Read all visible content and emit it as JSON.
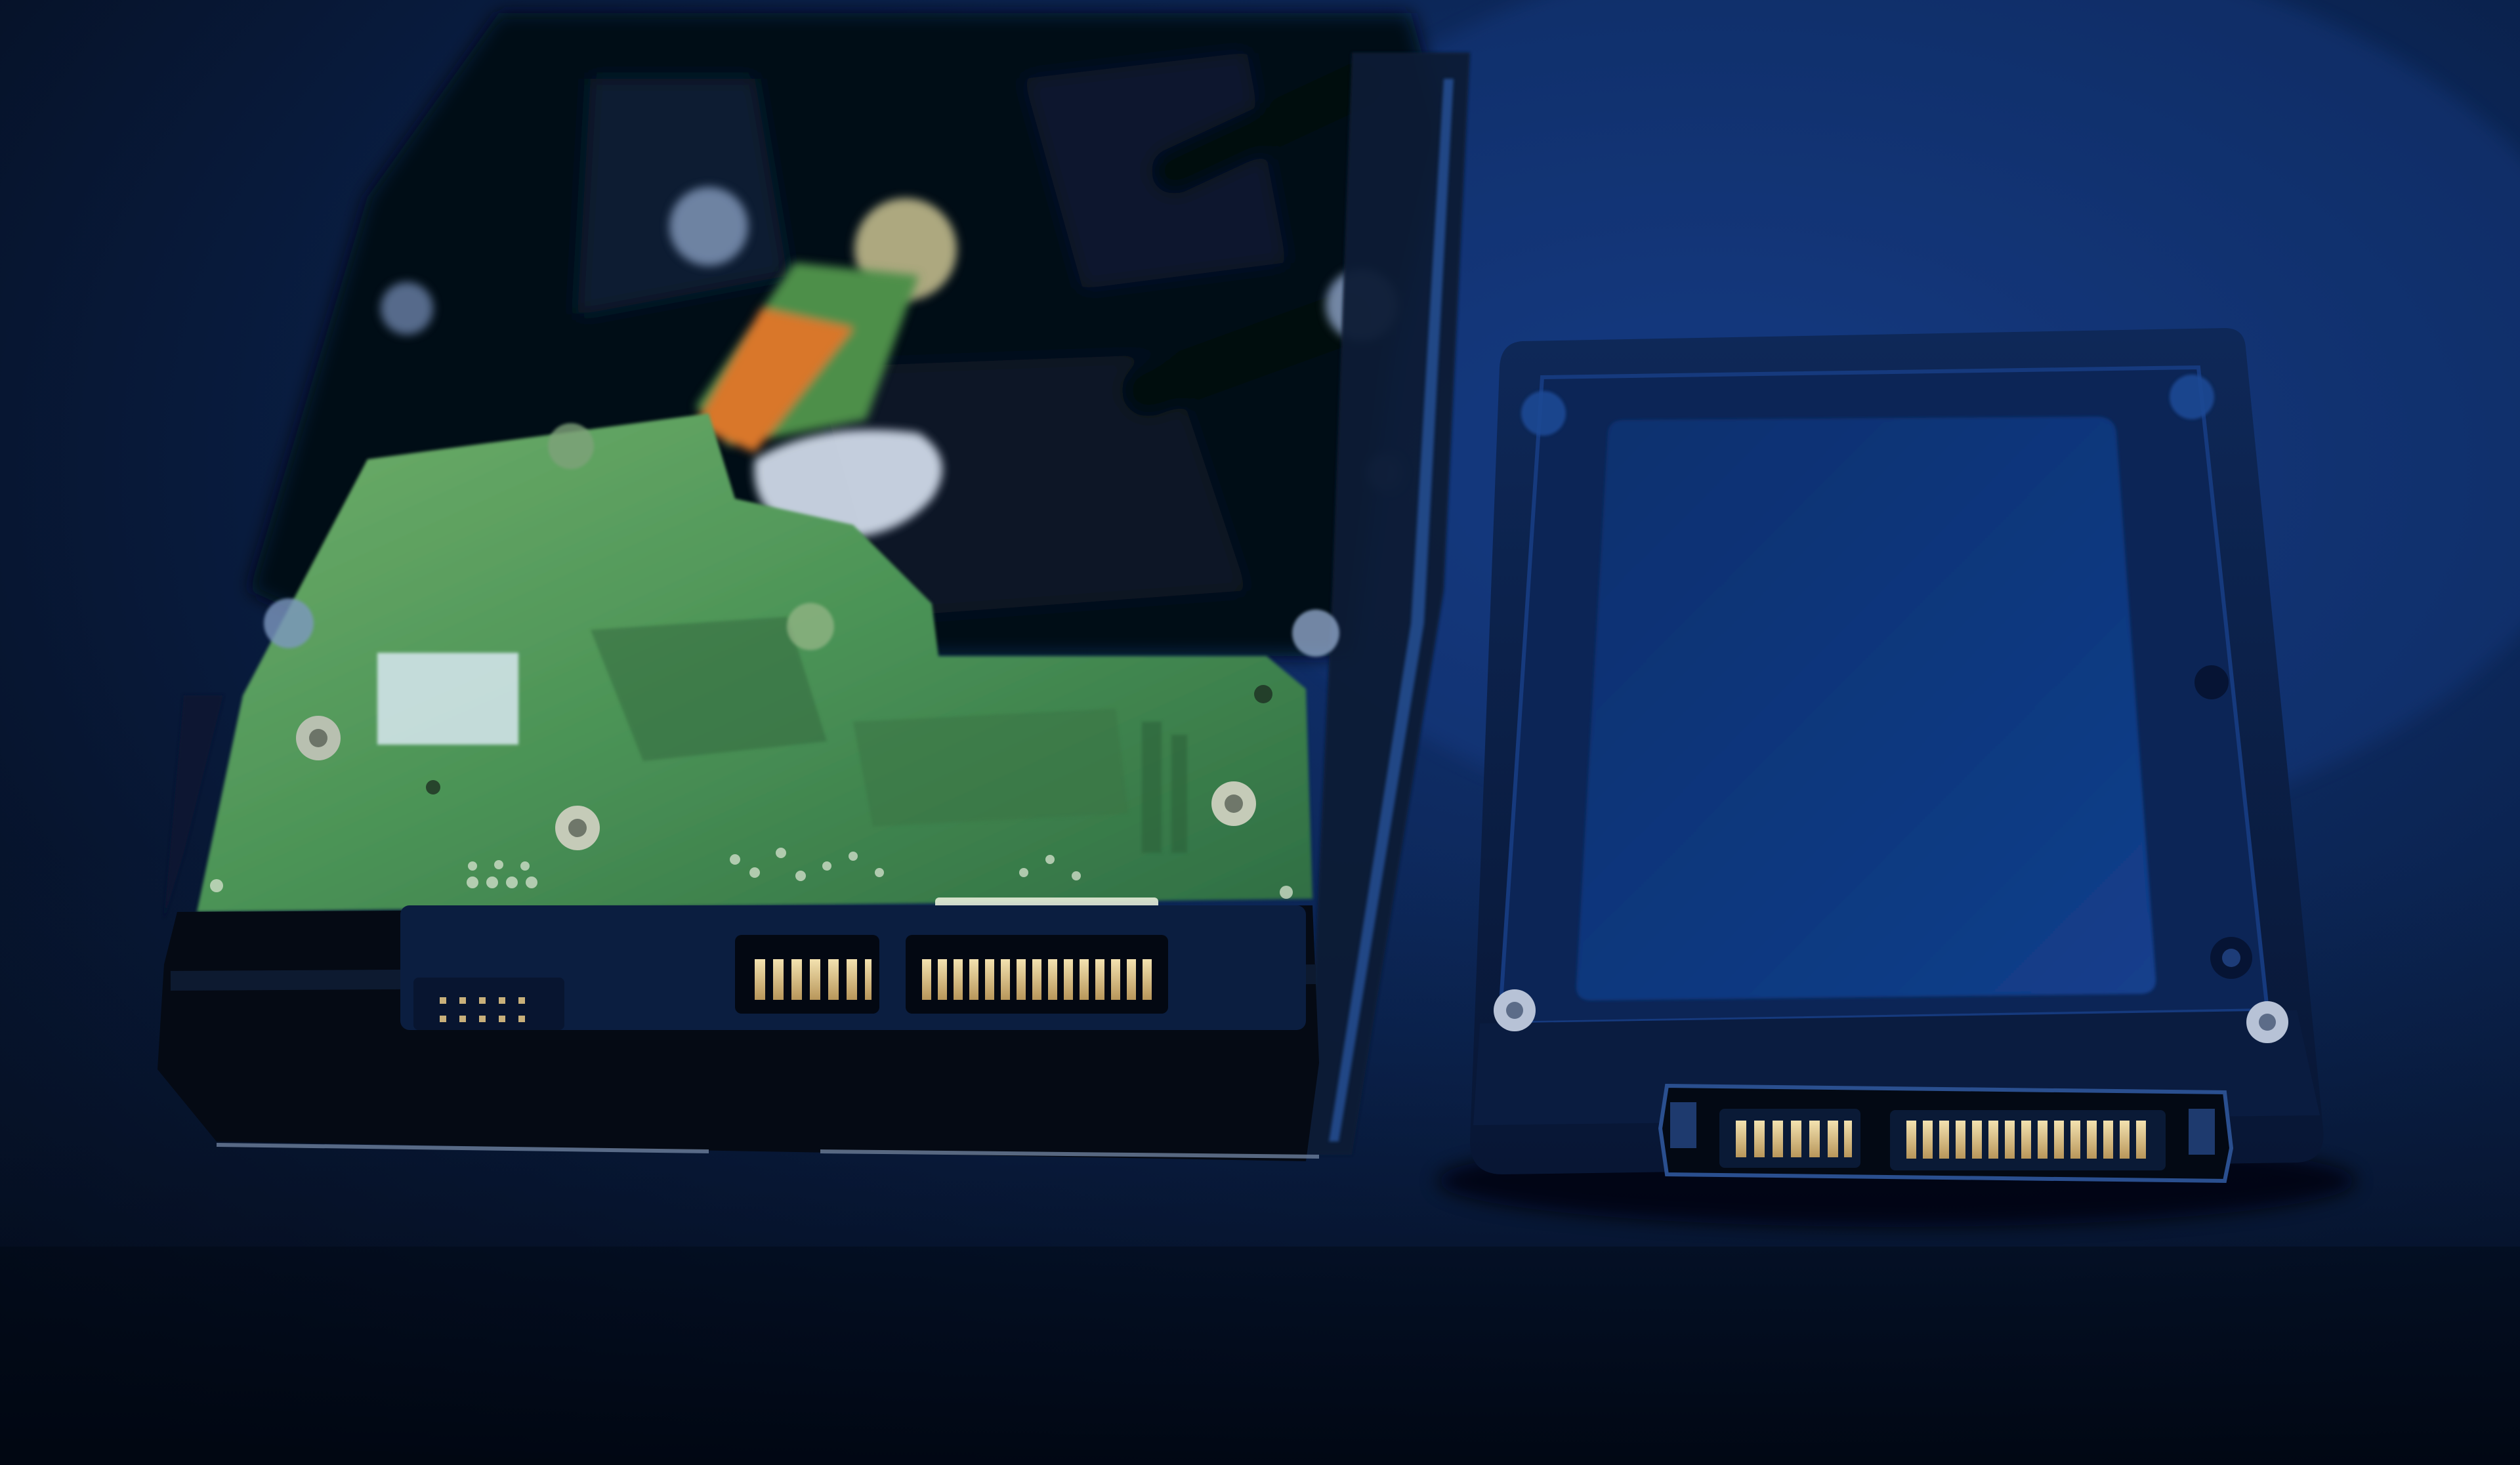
{
  "scene": {
    "description_kind": "photo",
    "subjects": [
      "hard-disk-drive",
      "solid-state-drive"
    ],
    "colors": {
      "background_dark": "#050f20",
      "background_blue": "#0d2a5c",
      "hdd_frame": "#070d18",
      "pcb_green": "#3f8a4c",
      "pcb_green_light": "#6fae6a",
      "ssd_body": "#0a1e46",
      "ssd_panel": "#103a85",
      "connector_gold": "#e2c98a",
      "ribbon_orange": "#d9772c"
    },
    "connectors": {
      "hdd_pins_small": 7,
      "hdd_pins_large": 15,
      "ssd_pins_small": 7,
      "ssd_pins_large": 15
    }
  }
}
